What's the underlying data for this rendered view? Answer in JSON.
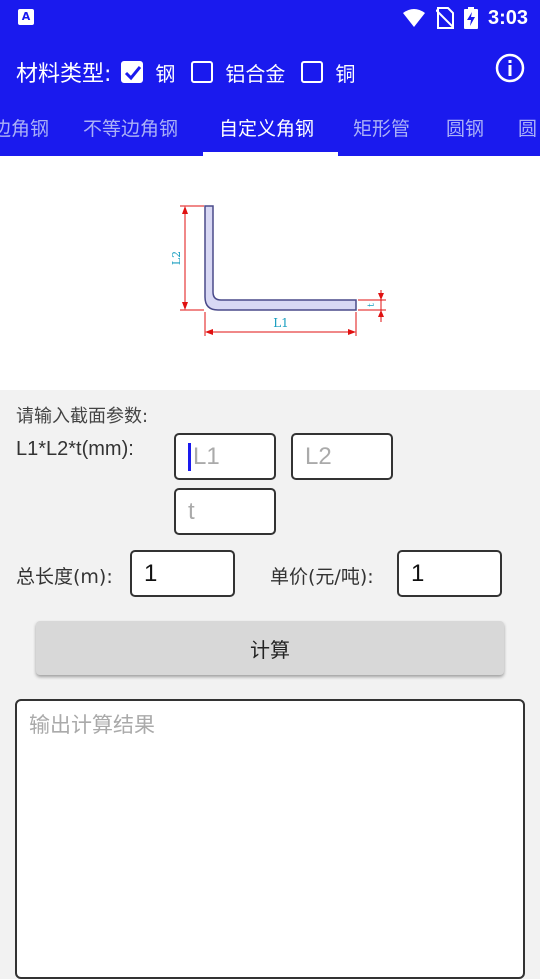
{
  "status_bar": {
    "time": "3:03",
    "app_icon_letter": "A"
  },
  "material": {
    "label": "材料类型:",
    "options": [
      {
        "label": "钢",
        "checked": true
      },
      {
        "label": "铝合金",
        "checked": false
      },
      {
        "label": "铜",
        "checked": false
      }
    ]
  },
  "tabs": [
    "边角钢",
    "不等边角钢",
    "自定义角钢",
    "矩形管",
    "圆钢",
    "圆"
  ],
  "active_tab": "自定义角钢",
  "diagram": {
    "label_l1": "L1",
    "label_l2": "L2",
    "label_t": "t"
  },
  "form": {
    "section_title": "请输入截面参数:",
    "dims_label": "L1*L2*t(mm):",
    "l1_placeholder": "L1",
    "l2_placeholder": "L2",
    "t_placeholder": "t",
    "length_label": "总长度(m):",
    "length_value": "1",
    "price_label": "单价(元/吨):",
    "price_value": "1"
  },
  "calc_button": "计算",
  "output_placeholder": "输出计算结果",
  "colors": {
    "primary": "#1a1aee",
    "tab_inactive": "#aab0f7",
    "dimension_red": "#e01010",
    "dimension_cyan": "#1a9fc0"
  }
}
